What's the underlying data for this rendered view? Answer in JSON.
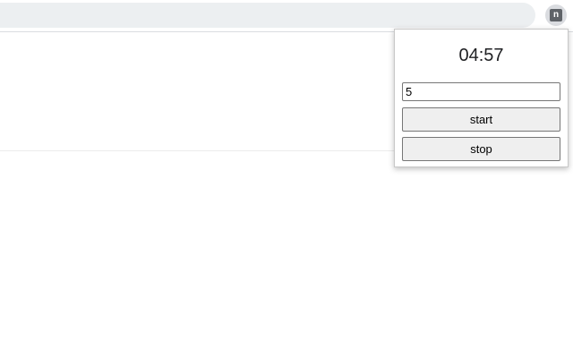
{
  "toolbar": {
    "extension_icon_letter": "n"
  },
  "popup": {
    "timer": "04:57",
    "minutes_value": "5",
    "start_label": "start",
    "stop_label": "stop"
  },
  "colors": {
    "omnibox_bg": "#eceff1",
    "popup_border": "#c8c8c8",
    "button_bg": "#efefef"
  },
  "icons": {
    "extension": "extension-icon"
  }
}
